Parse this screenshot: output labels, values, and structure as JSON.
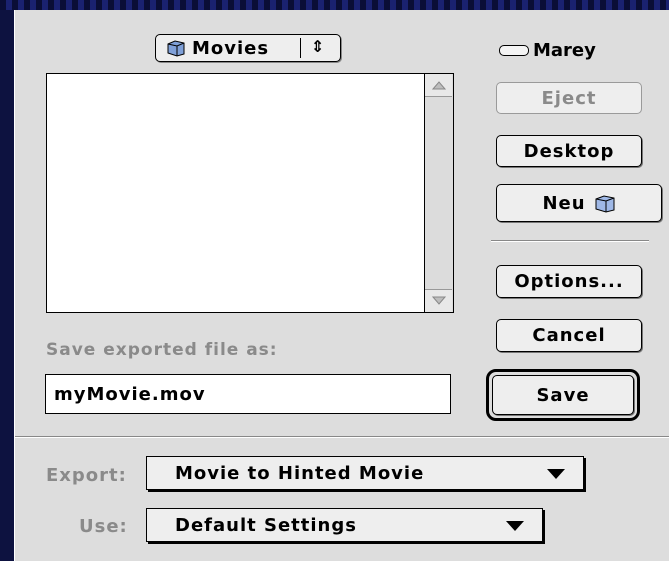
{
  "folder_popup": {
    "label": "Movies",
    "icon": "folder-icon",
    "arrows": "⇕"
  },
  "file_list": {
    "items": []
  },
  "volume": {
    "name": "Marey",
    "icon": "disk-icon"
  },
  "buttons": {
    "eject": "Eject",
    "desktop": "Desktop",
    "new_folder": "Neu",
    "options": "Options...",
    "cancel": "Cancel",
    "save": "Save"
  },
  "save_prompt": "Save exported file as:",
  "filename": {
    "value": "myMovie.mov"
  },
  "export": {
    "label": "Export:",
    "value": "Movie to Hinted Movie"
  },
  "use": {
    "label": "Use:",
    "value": "Default Settings"
  }
}
